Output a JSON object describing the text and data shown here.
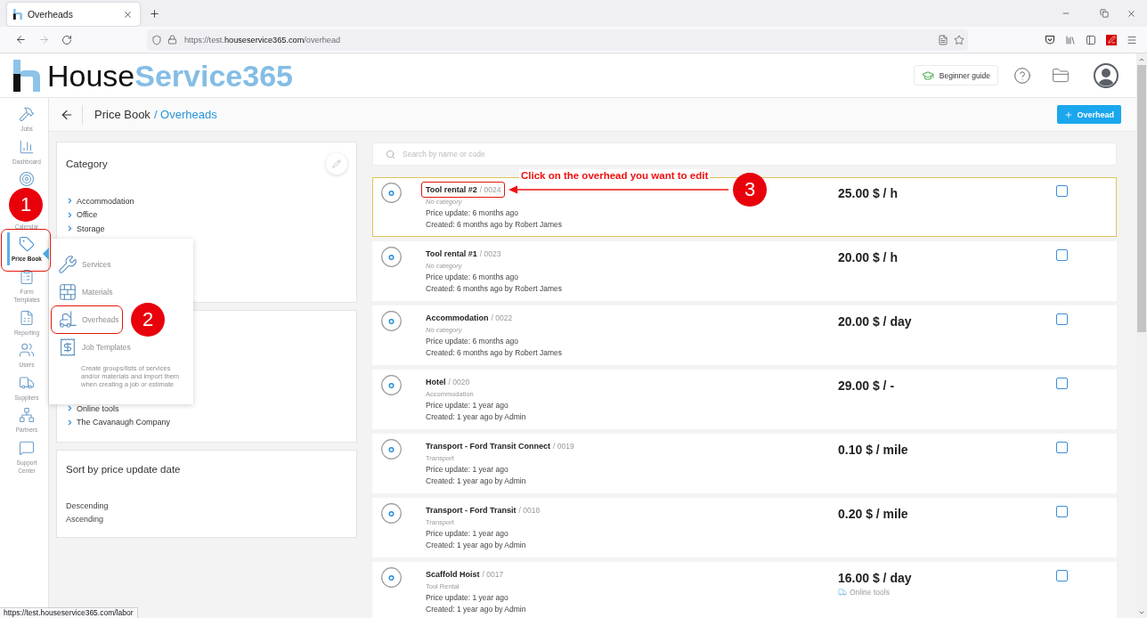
{
  "browser": {
    "tab": {
      "title": "Overheads"
    },
    "address": {
      "scheme": "https://test.",
      "domain": "houseservice365.com",
      "path": "/overhead"
    },
    "status_url": "https://test.houseservice365.com/labor"
  },
  "header": {
    "logo": {
      "first": "House",
      "second": "Service365"
    },
    "guide_button": "Beginner guide"
  },
  "sidebar": {
    "items": [
      {
        "label": "Jobs",
        "icon": true,
        "selected": false
      },
      {
        "label": "Dashboard",
        "icon": true,
        "selected": false
      },
      {
        "icon": true,
        "selected": false
      },
      {
        "label": "Calendar",
        "icon": false,
        "selected": false
      },
      {
        "label": "Price Book",
        "icon": true,
        "selected": true,
        "step": "1"
      },
      {
        "label": "Form Templates",
        "icon": true,
        "selected": false
      },
      {
        "label": "Reporting",
        "icon": true,
        "selected": false
      },
      {
        "label": "Users",
        "icon": true,
        "selected": false
      },
      {
        "label": "Suppliers",
        "icon": true,
        "selected": false
      },
      {
        "label": "Partners",
        "icon": true,
        "selected": false
      },
      {
        "label": "Support Center",
        "icon": true,
        "selected": false
      }
    ]
  },
  "price_book_menu": {
    "items": [
      {
        "label": "Services"
      },
      {
        "label": "Materials"
      },
      {
        "label": "Overheads",
        "step": "2"
      },
      {
        "label": "Job Templates"
      }
    ],
    "description": "Create groups/lists of services and/or materials and import them when creating a job or estimate"
  },
  "breadcrumb": {
    "parent": "Price Book",
    "current": "/ Overheads"
  },
  "add_button": {
    "label": "Overhead"
  },
  "filters": {
    "category": {
      "title": "Category",
      "items": [
        "Accommodation",
        "Office",
        "Storage"
      ]
    },
    "card_2": {
      "items": [
        "Online tools",
        "The Cavanaugh Company"
      ]
    },
    "sort": {
      "title": "Sort by price update date",
      "options": [
        "Descending",
        "Ascending"
      ]
    }
  },
  "search": {
    "placeholder": "Search by name or code"
  },
  "overheads": [
    {
      "name": "Tool rental #2",
      "code": "/ 0024",
      "category": "No category",
      "uncategorized": true,
      "price_update": "Price update: 6 months ago",
      "created": "Created: 6 months ago by Robert James",
      "price": "25.00 $ / h",
      "selected": true,
      "checked": false,
      "callout": {
        "step": "3",
        "note": "Click on the overhead you want to edit"
      }
    },
    {
      "name": "Tool rental #1",
      "code": "/ 0023",
      "category": "No category",
      "uncategorized": true,
      "price_update": "Price update: 6 months ago",
      "created": "Created: 6 months ago by Robert James",
      "price": "20.00 $ / h",
      "selected": false,
      "checked": false
    },
    {
      "name": "Accommodation",
      "code": "/ 0022",
      "category": "No category",
      "uncategorized": true,
      "price_update": "Price update: 6 months ago",
      "created": "Created: 6 months ago by Robert James",
      "price": "20.00 $ / day",
      "selected": false,
      "checked": false
    },
    {
      "name": "Hotel",
      "code": "/ 0020",
      "category": "Accommodation",
      "uncategorized": false,
      "price_update": "Price update: 1 year ago",
      "created": "Created: 1 year ago by Admin",
      "price": "29.00 $ / -",
      "selected": false,
      "checked": false
    },
    {
      "name": "Transport - Ford Transit Connect",
      "code": "/ 0019",
      "category": "Transport",
      "uncategorized": false,
      "price_update": "Price update: 1 year ago",
      "created": "Created: 1 year ago by Admin",
      "price": "0.10 $ / mile",
      "selected": false,
      "checked": false
    },
    {
      "name": "Transport - Ford Transit",
      "code": "/ 0018",
      "category": "Transport",
      "uncategorized": false,
      "price_update": "Price update: 1 year ago",
      "created": "Created: 1 year ago by Admin",
      "price": "0.20 $ / mile",
      "selected": false,
      "checked": false
    },
    {
      "name": "Scaffold Hoist",
      "code": "/ 0017",
      "category": "Tool Rental",
      "uncategorized": false,
      "price_update": "Price update: 1 year ago",
      "created": "Created: 1 year ago by Admin",
      "price": "16.00 $ / day",
      "supplier": "Online tools",
      "selected": false,
      "checked": false
    }
  ]
}
